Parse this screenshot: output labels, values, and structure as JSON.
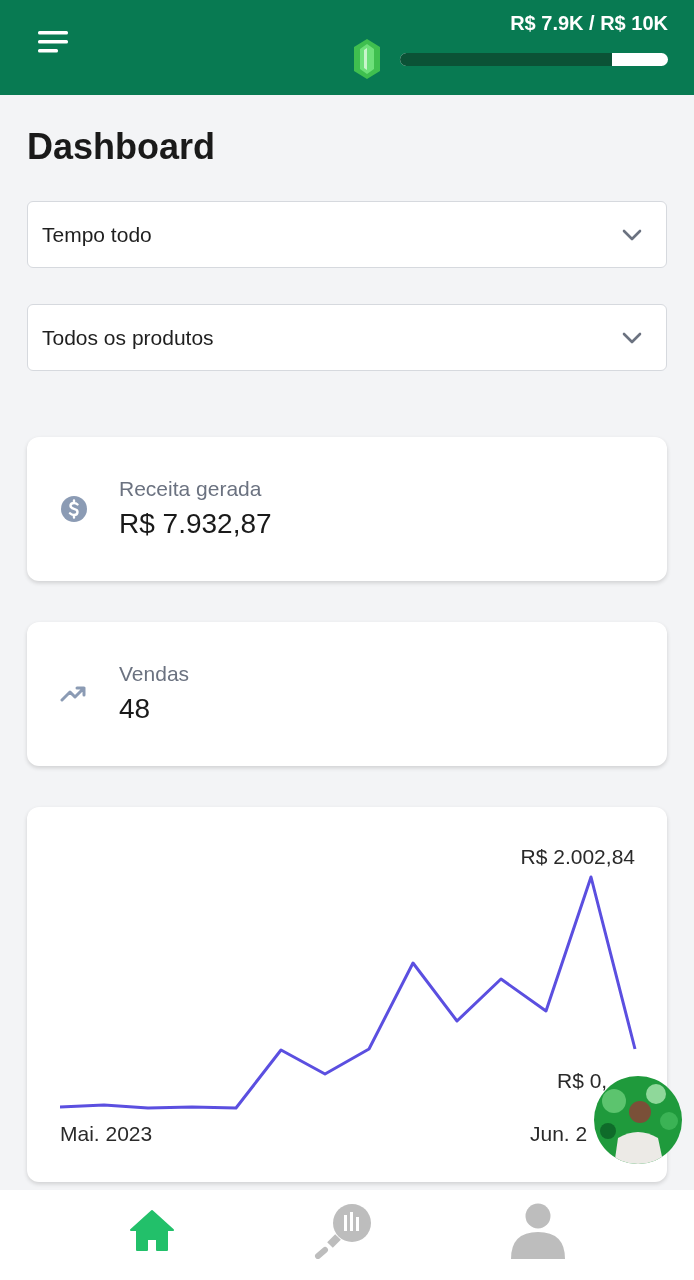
{
  "header": {
    "goal_text": "R$ 7.9K / R$ 10K",
    "goal_progress": {
      "level": 0.79
    }
  },
  "title": "Dashboard",
  "filters": [
    {
      "value": "Tempo todo"
    },
    {
      "value": "Todos os produtos"
    }
  ],
  "stats": [
    {
      "kind": "revenue",
      "label": "Receita gerada",
      "value": "R$ 7.932,87"
    },
    {
      "kind": "sales",
      "label": "Vendas",
      "value": "48"
    }
  ],
  "chart": {
    "max_label": "R$ 2.002,84",
    "min_label": "R$ 0,",
    "start_label": "Mai. 2023",
    "end_label": "Jun. 2"
  },
  "bottom_nav": [
    {
      "kind": "home",
      "selected": true
    },
    {
      "kind": "reports",
      "selected": false
    },
    {
      "kind": "profile",
      "selected": false
    }
  ]
}
